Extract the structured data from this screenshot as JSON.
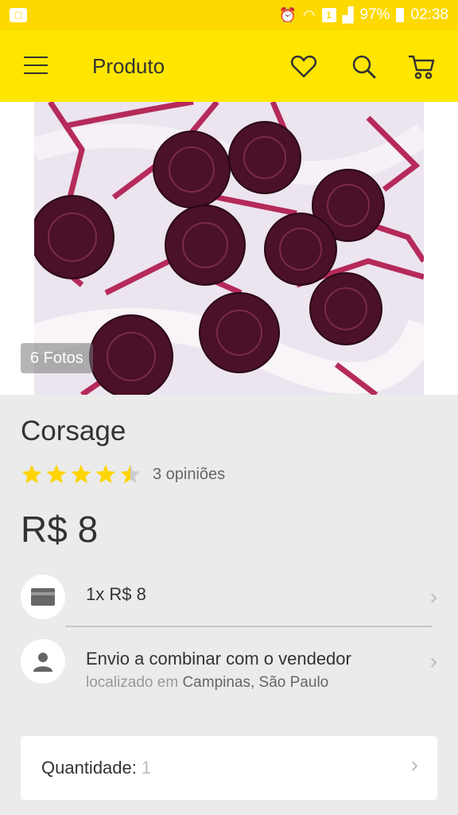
{
  "status_bar": {
    "battery_percent": "97%",
    "time": "02:38",
    "left_icon": "app-notification-icon",
    "sim_badge": "1"
  },
  "app_bar": {
    "title": "Produto",
    "icons": [
      "menu-icon",
      "heart-icon",
      "search-icon",
      "cart-icon"
    ]
  },
  "gallery": {
    "photo_count_label": "6 Fotos"
  },
  "product": {
    "title": "Corsage",
    "rating": 4.5,
    "rating_text": "3 opiniões",
    "price": "R$ 8"
  },
  "payment": {
    "installment": "1x R$ 8"
  },
  "shipping": {
    "main": "Envio a combinar com o vendedor",
    "location_prefix": "localizado em",
    "location": "Campinas, São Paulo"
  },
  "quantity": {
    "label": "Quantidade:",
    "value": "1"
  },
  "colors": {
    "brand_yellow": "#ffe600",
    "status_yellow": "#fdd900",
    "star": "#ffd400"
  }
}
